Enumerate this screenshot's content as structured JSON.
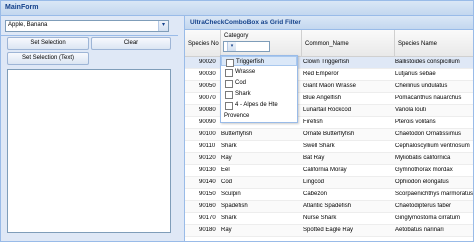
{
  "window": {
    "title": "MainForm"
  },
  "left": {
    "combo_value": "Apple, Banana",
    "buttons": {
      "set_selection": "Set Selection",
      "clear": "Clear",
      "set_selection_text": "Set Selection (Text)"
    }
  },
  "grid": {
    "title": "UltraCheckComboBox as Grid Filter",
    "columns": {
      "species_no": "Species No",
      "category": "Category",
      "common_name": "Common_Name",
      "species_name": "Species Name"
    },
    "rows": [
      {
        "no": "90020",
        "cat": "",
        "common": "Clown Triggerfish",
        "species": "Ballistoides conspicillum"
      },
      {
        "no": "90030",
        "cat": "",
        "common": "Red Emperor",
        "species": "Lutjanus sebae"
      },
      {
        "no": "90050",
        "cat": "",
        "common": "Giant Maori Wrasse",
        "species": "Cheilinus undulatus"
      },
      {
        "no": "90070",
        "cat": "",
        "common": "Blue Angelfish",
        "species": "Pomacanthus nauarchus"
      },
      {
        "no": "90080",
        "cat": "",
        "common": "Lunartail Rockcod",
        "species": "Variola louti"
      },
      {
        "no": "90090",
        "cat": "",
        "common": "Firefish",
        "species": "Pterois volitans"
      },
      {
        "no": "90100",
        "cat": "Butterflyfish",
        "common": "Ornate Butterflyfish",
        "species": "Chaetodon Ornatissimus"
      },
      {
        "no": "90110",
        "cat": "Shark",
        "common": "Swell Shark",
        "species": "Cephaloscyllium ventriosum"
      },
      {
        "no": "90120",
        "cat": "Ray",
        "common": "Bat Ray",
        "species": "Myliobatis californica"
      },
      {
        "no": "90130",
        "cat": "Eel",
        "common": "California Moray",
        "species": "Gymnothorax mordax"
      },
      {
        "no": "90140",
        "cat": "Cod",
        "common": "Lingcod",
        "species": "Ophiodon elongatus"
      },
      {
        "no": "90150",
        "cat": "Sculpin",
        "common": "Cabezon",
        "species": "Scorpaenichthys marmoratus"
      },
      {
        "no": "90160",
        "cat": "Spadefish",
        "common": "Atlantic Spadefish",
        "species": "Chaetodipterus faber"
      },
      {
        "no": "90170",
        "cat": "Shark",
        "common": "Nurse Shark",
        "species": "Ginglymostoma cirratum"
      },
      {
        "no": "90180",
        "cat": "Ray",
        "common": "Spotted Eagle Ray",
        "species": "Aetobatus narinari"
      }
    ]
  },
  "dropdown": {
    "items": [
      {
        "label": "Triggerfish"
      },
      {
        "label": "Wrasse"
      },
      {
        "label": "Cod"
      },
      {
        "label": "Shark"
      },
      {
        "label": "4 - Alpes de Hte"
      }
    ],
    "footer": "Provence"
  },
  "colors": {
    "accent": "#15428b",
    "panel": "#dfe8f6",
    "border": "#99bbe8"
  }
}
